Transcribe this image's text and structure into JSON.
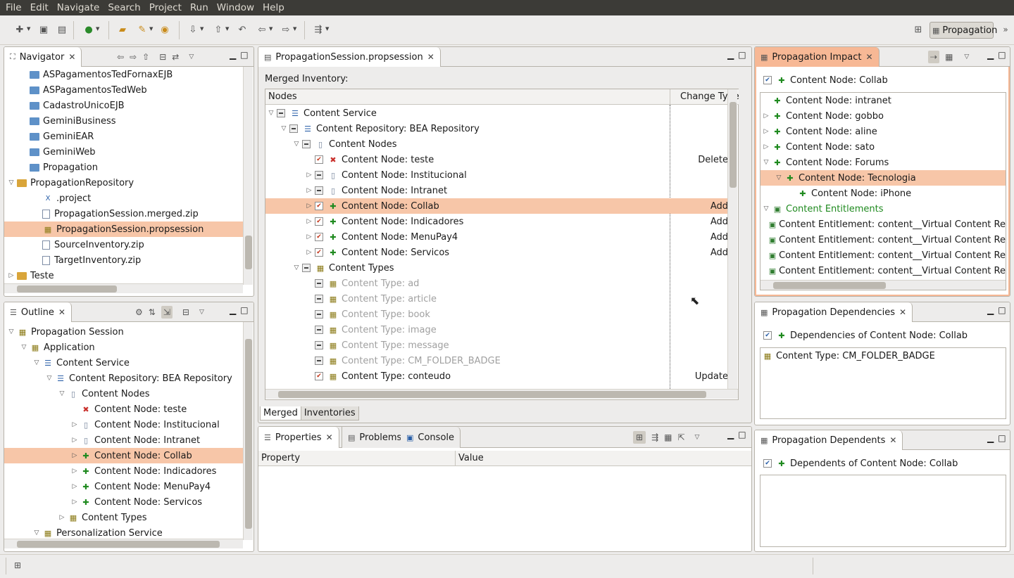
{
  "menu": [
    "File",
    "Edit",
    "Navigate",
    "Search",
    "Project",
    "Run",
    "Window",
    "Help"
  ],
  "perspective": {
    "label": "Propagation"
  },
  "navigator": {
    "tab": "Navigator",
    "items": [
      {
        "label": "ASPagamentosTedFornaxEJB",
        "type": "folder",
        "indent": 1
      },
      {
        "label": "ASPagamentosTedWeb",
        "type": "folder",
        "indent": 1
      },
      {
        "label": "CadastroUnicoEJB",
        "type": "folder",
        "indent": 1
      },
      {
        "label": "GeminiBusiness",
        "type": "folder",
        "indent": 1
      },
      {
        "label": "GeminiEAR",
        "type": "folder",
        "indent": 1
      },
      {
        "label": "GeminiWeb",
        "type": "folder",
        "indent": 1
      },
      {
        "label": "Propagation",
        "type": "folder",
        "indent": 1
      },
      {
        "label": "PropagationRepository",
        "type": "project",
        "indent": 0,
        "twisty": "open"
      },
      {
        "label": ".project",
        "type": "x",
        "indent": 2
      },
      {
        "label": "PropagationSession.merged.zip",
        "type": "file",
        "indent": 2
      },
      {
        "label": "PropagationSession.propsession",
        "type": "session",
        "indent": 2,
        "selected": true
      },
      {
        "label": "SourceInventory.zip",
        "type": "file",
        "indent": 2
      },
      {
        "label": "TargetInventory.zip",
        "type": "file",
        "indent": 2
      },
      {
        "label": "Teste",
        "type": "project",
        "indent": 0,
        "twisty": "closed"
      }
    ]
  },
  "outline": {
    "tab": "Outline",
    "items": [
      {
        "label": "Propagation Session",
        "indent": 0,
        "twisty": "open",
        "icon": "session"
      },
      {
        "label": "Application",
        "indent": 1,
        "twisty": "open",
        "icon": "app"
      },
      {
        "label": "Content Service",
        "indent": 2,
        "twisty": "open",
        "icon": "service"
      },
      {
        "label": "Content Repository: BEA Repository",
        "indent": 3,
        "twisty": "open",
        "icon": "repo"
      },
      {
        "label": "Content Nodes",
        "indent": 4,
        "twisty": "open",
        "icon": "doc"
      },
      {
        "label": "Content Node: teste",
        "indent": 5,
        "icon": "delete"
      },
      {
        "label": "Content Node: Institucional",
        "indent": 5,
        "twisty": "closed",
        "icon": "doc"
      },
      {
        "label": "Content Node: Intranet",
        "indent": 5,
        "twisty": "closed",
        "icon": "doc"
      },
      {
        "label": "Content Node: Collab",
        "indent": 5,
        "twisty": "closed",
        "icon": "add",
        "selected": true
      },
      {
        "label": "Content Node: Indicadores",
        "indent": 5,
        "twisty": "closed",
        "icon": "add"
      },
      {
        "label": "Content Node: MenuPay4",
        "indent": 5,
        "twisty": "closed",
        "icon": "add"
      },
      {
        "label": "Content Node: Servicos",
        "indent": 5,
        "twisty": "closed",
        "icon": "add"
      },
      {
        "label": "Content Types",
        "indent": 4,
        "twisty": "closed",
        "icon": "types"
      },
      {
        "label": "Personalization Service",
        "indent": 2,
        "twisty": "open",
        "icon": "service2"
      }
    ]
  },
  "editor": {
    "tab": "PropagationSession.propsession",
    "heading": "Merged Inventory:",
    "col_nodes": "Nodes",
    "col_change": "Change Type",
    "rows": [
      {
        "label": "Content Service",
        "indent": 0,
        "twisty": "open",
        "cb": "gray",
        "icon": "service",
        "change": ""
      },
      {
        "label": "Content Repository: BEA Repository",
        "indent": 1,
        "twisty": "open",
        "cb": "gray",
        "icon": "repo",
        "change": ""
      },
      {
        "label": "Content Nodes",
        "indent": 2,
        "twisty": "open",
        "cb": "gray",
        "icon": "doc",
        "change": ""
      },
      {
        "label": "Content Node: teste",
        "indent": 3,
        "cb": "checked",
        "icon": "delete",
        "change": "Delete"
      },
      {
        "label": "Content Node: Institucional",
        "indent": 3,
        "twisty": "closed",
        "cb": "gray",
        "icon": "doc",
        "change": ""
      },
      {
        "label": "Content Node: Intranet",
        "indent": 3,
        "twisty": "closed",
        "cb": "gray",
        "icon": "doc",
        "change": ""
      },
      {
        "label": "Content Node: Collab",
        "indent": 3,
        "twisty": "closed",
        "cb": "checked",
        "icon": "add",
        "change": "Add",
        "selected": true
      },
      {
        "label": "Content Node: Indicadores",
        "indent": 3,
        "twisty": "closed",
        "cb": "checked",
        "icon": "add",
        "change": "Add"
      },
      {
        "label": "Content Node: MenuPay4",
        "indent": 3,
        "twisty": "closed",
        "cb": "checked",
        "icon": "add",
        "change": "Add"
      },
      {
        "label": "Content Node: Servicos",
        "indent": 3,
        "twisty": "closed",
        "cb": "checked",
        "icon": "add",
        "change": "Add"
      },
      {
        "label": "Content Types",
        "indent": 2,
        "twisty": "open",
        "cb": "gray",
        "icon": "types",
        "change": ""
      },
      {
        "label": "Content Type: ad",
        "indent": 3,
        "cb": "gray",
        "icon": "types",
        "change": "",
        "muted": true
      },
      {
        "label": "Content Type: article",
        "indent": 3,
        "cb": "gray",
        "icon": "types",
        "change": "",
        "muted": true
      },
      {
        "label": "Content Type: book",
        "indent": 3,
        "cb": "gray",
        "icon": "types",
        "change": "",
        "muted": true
      },
      {
        "label": "Content Type: image",
        "indent": 3,
        "cb": "gray",
        "icon": "types",
        "change": "",
        "muted": true
      },
      {
        "label": "Content Type: message",
        "indent": 3,
        "cb": "gray",
        "icon": "types",
        "change": "",
        "muted": true
      },
      {
        "label": "Content Type: CM_FOLDER_BADGE",
        "indent": 3,
        "cb": "gray",
        "icon": "types",
        "change": "",
        "muted": true
      },
      {
        "label": "Content Type: conteudo",
        "indent": 3,
        "cb": "checked",
        "icon": "types",
        "change": "Update"
      }
    ],
    "bottom_tabs": [
      "Merged",
      "Inventories"
    ]
  },
  "properties": {
    "tabs": [
      "Properties",
      "Problems",
      "Console"
    ],
    "col_property": "Property",
    "col_value": "Value"
  },
  "impact": {
    "tab": "Propagation Impact",
    "header": "Content Node: Collab",
    "items": [
      {
        "label": "Content Node: intranet",
        "indent": 0,
        "icon": "add"
      },
      {
        "label": "Content Node: gobbo",
        "indent": 0,
        "twisty": "closed",
        "icon": "add"
      },
      {
        "label": "Content Node: aline",
        "indent": 0,
        "twisty": "closed",
        "icon": "add"
      },
      {
        "label": "Content Node: sato",
        "indent": 0,
        "twisty": "closed",
        "icon": "add"
      },
      {
        "label": "Content Node: Forums",
        "indent": 0,
        "twisty": "open",
        "icon": "add"
      },
      {
        "label": "Content Node: Tecnologia",
        "indent": 1,
        "twisty": "open",
        "icon": "add",
        "selected": true
      },
      {
        "label": "Content Node: iPhone",
        "indent": 2,
        "icon": "add"
      },
      {
        "label": "Content Entitlements",
        "indent": 0,
        "twisty": "open",
        "icon": "ent",
        "green": true
      },
      {
        "label": "Content Entitlement: content__Virtual Content Re",
        "indent": 1,
        "icon": "ent"
      },
      {
        "label": "Content Entitlement: content__Virtual Content Re",
        "indent": 1,
        "icon": "ent"
      },
      {
        "label": "Content Entitlement: content__Virtual Content Re",
        "indent": 1,
        "icon": "ent"
      },
      {
        "label": "Content Entitlement: content__Virtual Content Re",
        "indent": 1,
        "icon": "ent"
      }
    ]
  },
  "dependencies": {
    "tab": "Propagation Dependencies",
    "header": "Dependencies of Content Node: Collab",
    "items": [
      {
        "label": "Content Type: CM_FOLDER_BADGE"
      }
    ]
  },
  "dependents": {
    "tab": "Propagation Dependents",
    "header": "Dependents of Content Node: Collab"
  },
  "colors": {
    "selection": "#f7c6a8",
    "active_tab": "#f7b895",
    "menubar": "#3c3b37"
  }
}
